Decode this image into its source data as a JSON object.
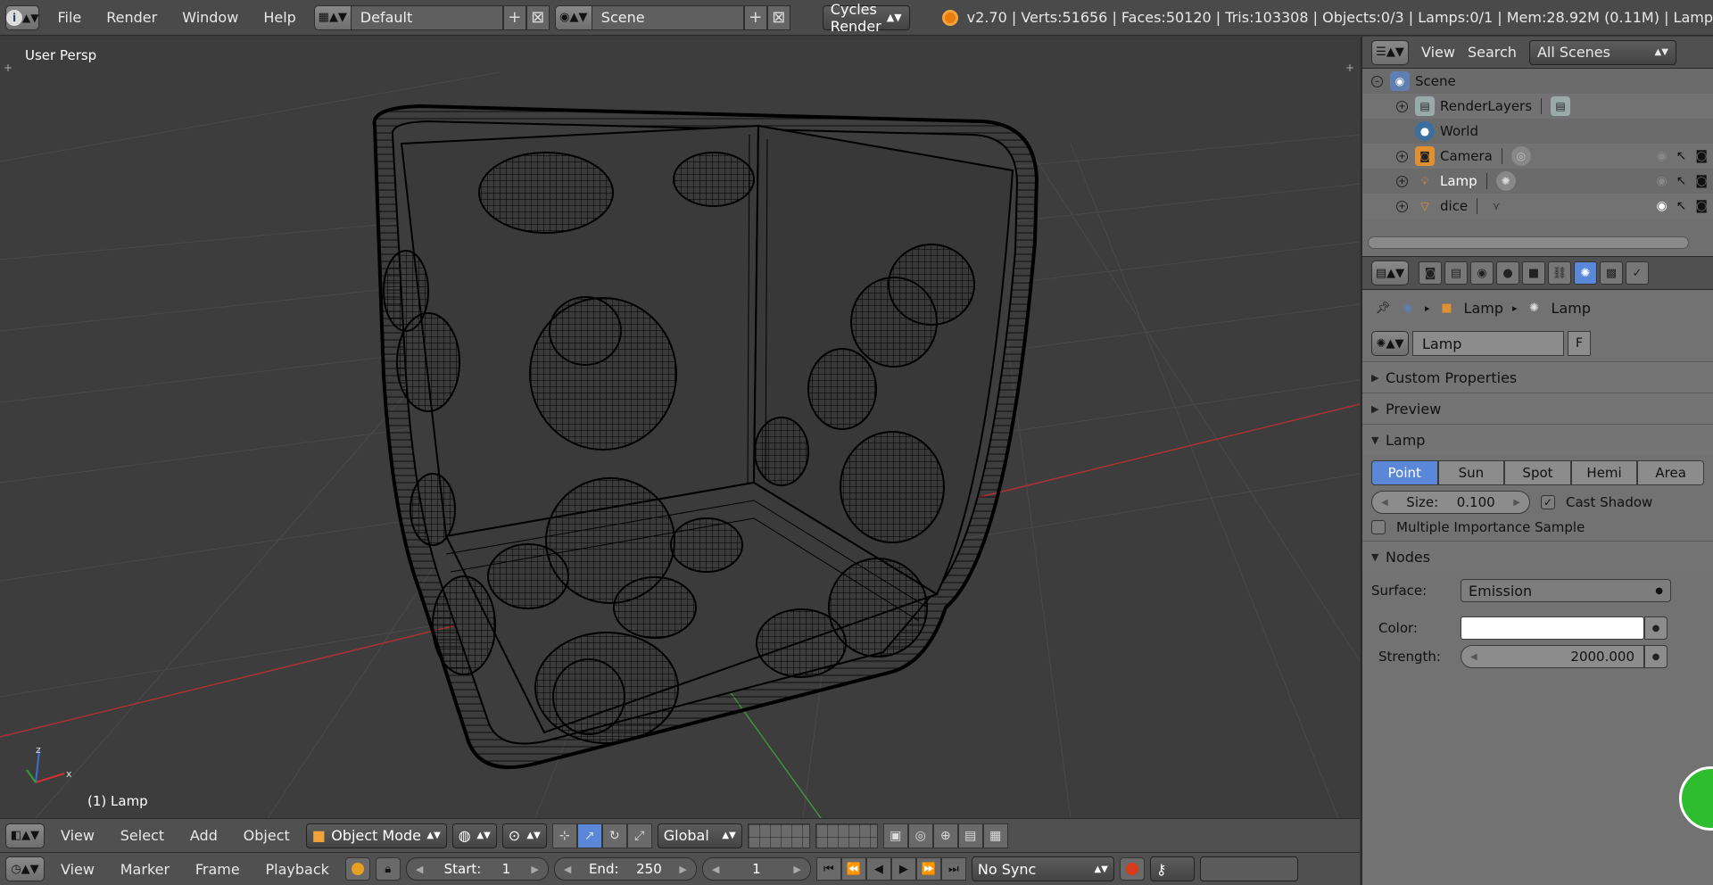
{
  "topbar": {
    "menus": [
      "File",
      "Render",
      "Window",
      "Help"
    ],
    "layout": "Default",
    "scene": "Scene",
    "engine": "Cycles Render",
    "stats": "v2.70 | Verts:51656 | Faces:50120 | Tris:103308 | Objects:0/3 | Lamps:0/1 | Mem:28.92M (0.11M) | Lamp"
  },
  "viewport": {
    "label": "User Persp",
    "object_label": "(1) Lamp",
    "axis_x": "x",
    "axis_z": "z"
  },
  "view_header": {
    "menus": [
      "View",
      "Select",
      "Add",
      "Object"
    ],
    "mode": "Object Mode",
    "orientation": "Global"
  },
  "timeline": {
    "menus": [
      "View",
      "Marker",
      "Frame",
      "Playback"
    ],
    "start_label": "Start:",
    "start": "1",
    "end_label": "End:",
    "end": "250",
    "current": "1",
    "sync": "No Sync"
  },
  "outliner": {
    "menus": [
      "View",
      "Search"
    ],
    "filter": "All Scenes",
    "items": [
      {
        "label": "Scene"
      },
      {
        "label": "RenderLayers"
      },
      {
        "label": "World"
      },
      {
        "label": "Camera"
      },
      {
        "label": "Lamp"
      },
      {
        "label": "dice"
      }
    ]
  },
  "properties": {
    "breadcrumb": [
      "Lamp",
      "Lamp"
    ],
    "datablock_name": "Lamp",
    "fake_user": "F",
    "panels": {
      "custom": "Custom Properties",
      "preview": "Preview",
      "lamp": "Lamp",
      "nodes": "Nodes"
    },
    "lamp_types": [
      "Point",
      "Sun",
      "Spot",
      "Hemi",
      "Area"
    ],
    "size_label": "Size:",
    "size_value": "0.100",
    "cast_shadow": "Cast Shadow",
    "mis": "Multiple Importance Sample",
    "surface_label": "Surface:",
    "surface_value": "Emission",
    "color_label": "Color:",
    "strength_label": "Strength:",
    "strength_value": "2000.000"
  },
  "colors": {
    "selected_blue": "#5a87d8",
    "viewport_bg": "#3d3d3d",
    "axis_red": "#b33030",
    "axis_green": "#3a9a3a"
  }
}
